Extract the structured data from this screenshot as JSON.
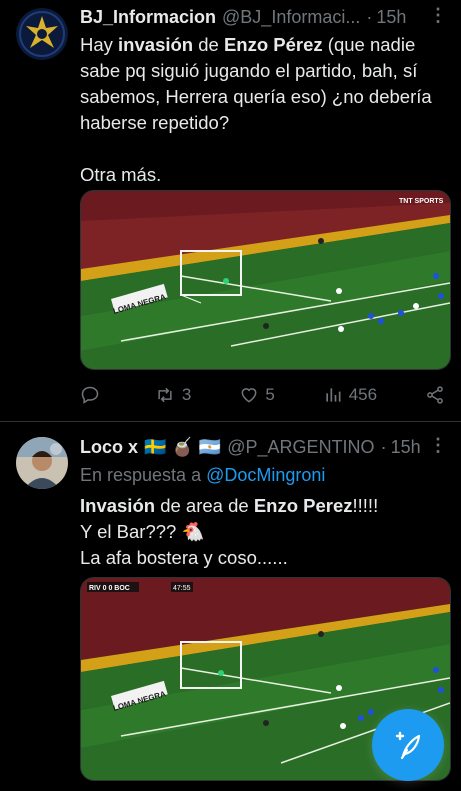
{
  "tweets": [
    {
      "name": "BJ_Informacion",
      "handle": "@BJ_Informaci...",
      "time": "15h",
      "text_parts": [
        "Hay ",
        "invasión",
        " de ",
        "Enzo Pérez",
        " (que nadie sabe pq siguió jugando el partido, bah, sí sabemos, Herrera quería eso) ¿no debería haberse repetido?"
      ],
      "text_line2": "Otra más.",
      "actions": {
        "reply": "",
        "retweet": "3",
        "like": "5",
        "views": "456"
      }
    },
    {
      "name": "Loco x",
      "name_emoji": "🇸🇪 🧉 🇦🇷",
      "handle": "@P_ARGENTINO",
      "time": "15h",
      "reply_prefix": "En respuesta a",
      "reply_mention": "@DocMingroni",
      "text_bold1": "Invasión",
      "text_mid": " de area de ",
      "text_bold2": "Enzo Perez",
      "text_end": "!!!!!",
      "line2": "Y el Bar??? 🐔",
      "line3": "La afa bostera y coso......"
    }
  ],
  "media1": {
    "tv_logo": "TNT SPORTS",
    "board": "LOMA NEGRA"
  },
  "media2": {
    "score": "RIV 0  0  BOC",
    "clock": "47:55",
    "board": "LOMA NEGRA"
  },
  "separator": "·",
  "more_icon": "⋮",
  "colors": {
    "accent": "#1d9bf0",
    "muted": "#71767b",
    "text": "#e7e9ea",
    "bg": "#000000"
  }
}
